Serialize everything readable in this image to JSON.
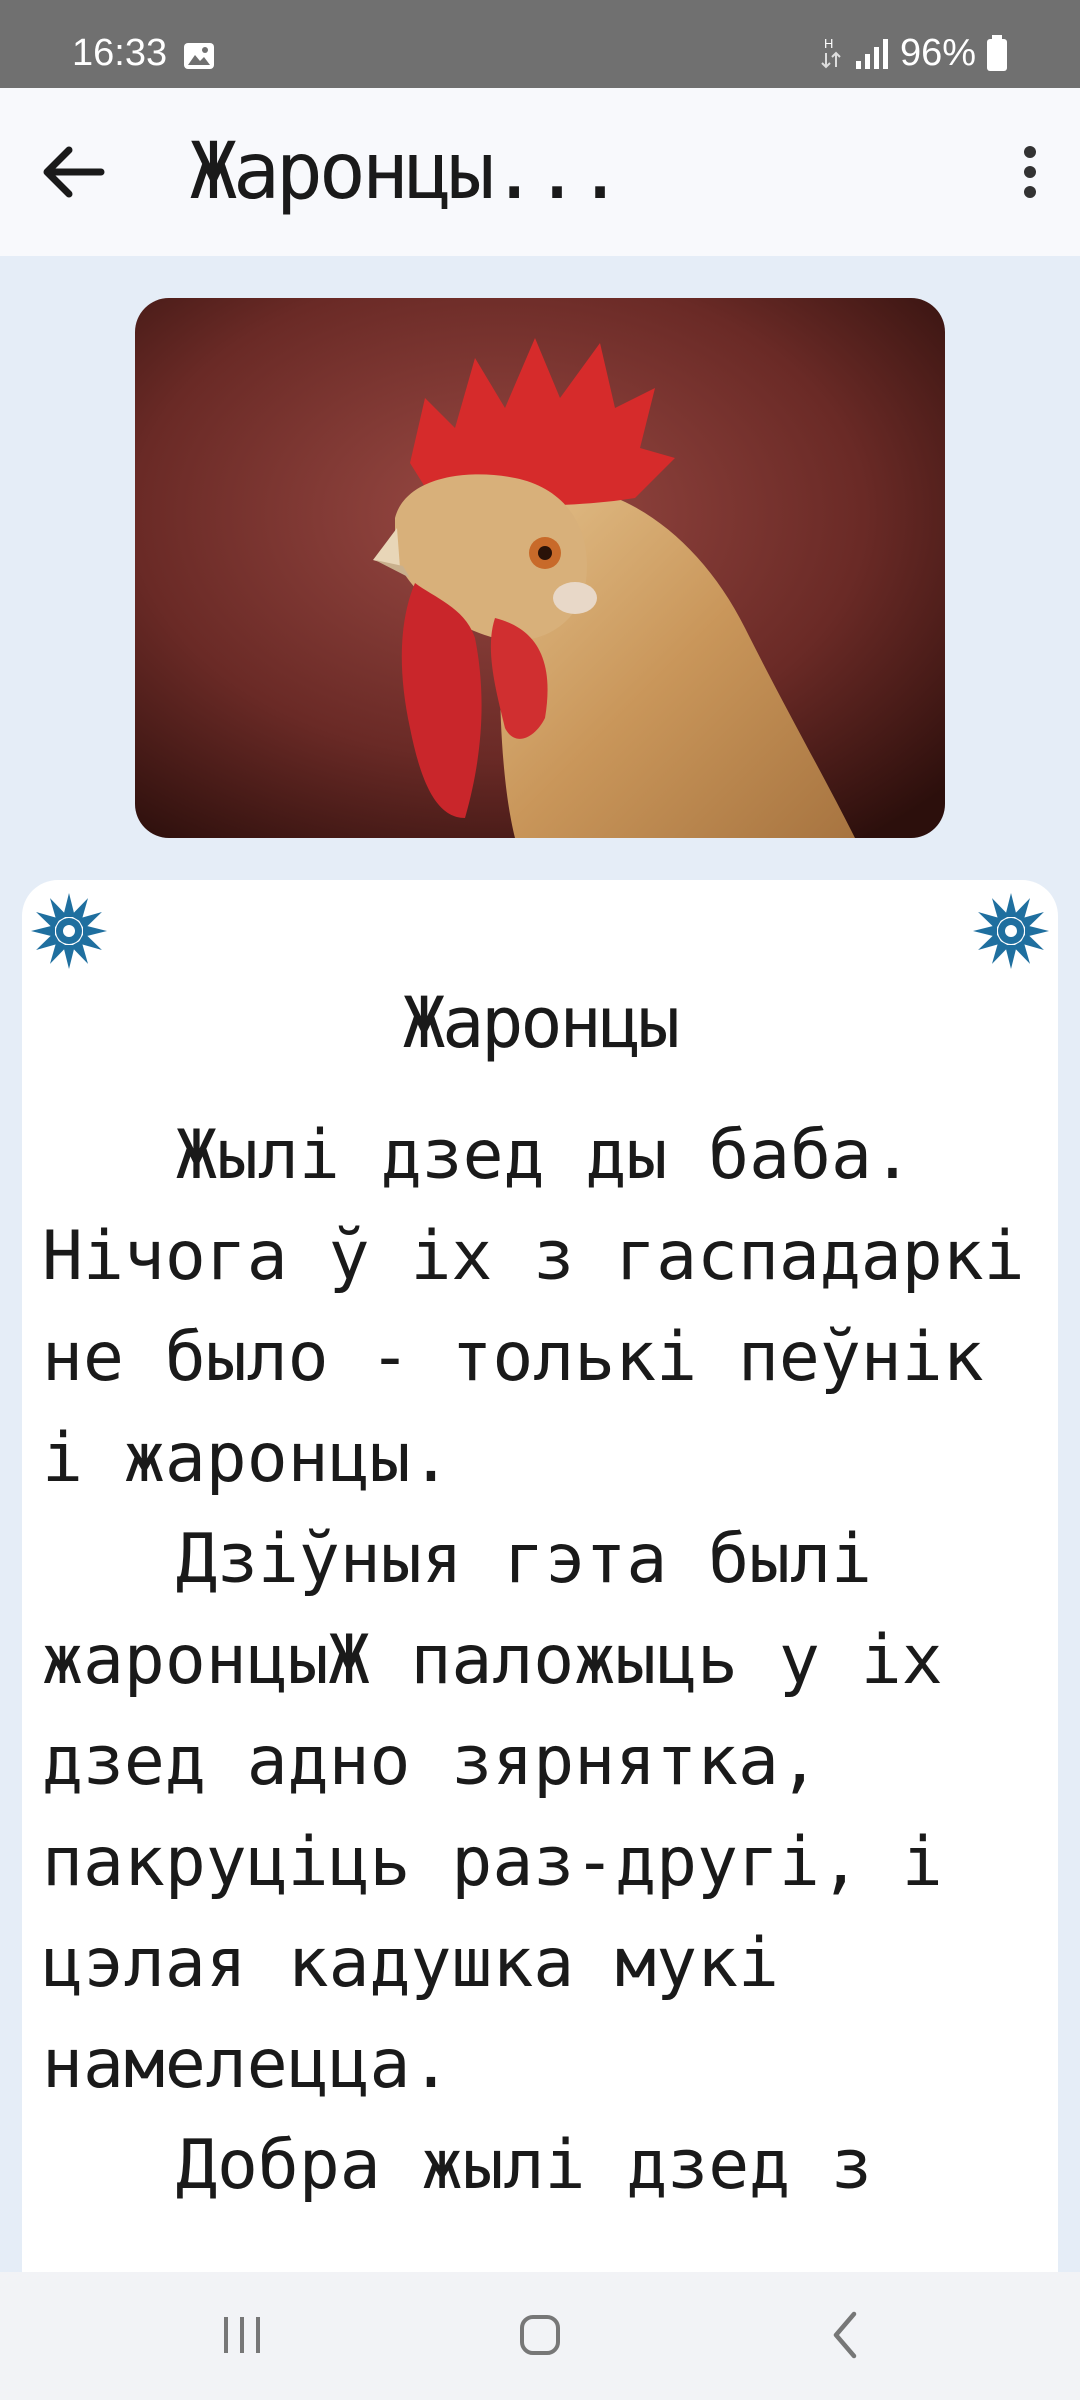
{
  "status_bar": {
    "time": "16:33",
    "battery": "96%",
    "icons": [
      "image-icon",
      "network-h-icon",
      "signal-icon",
      "battery-icon"
    ]
  },
  "app_bar": {
    "title": "Жаронцы...",
    "back_icon": "arrow-back-icon",
    "menu_icon": "more-vert-icon"
  },
  "hero": {
    "alt": "rooster-photo"
  },
  "story": {
    "title": "Жаронцы",
    "paragraphs": [
      "Жылі дзед ды баба. Нічога ў іх з гаспадаркі не было - толькі пеўнік і жаронцы.",
      "Дзіўныя гэта былі жаронцыЖ паложыць у іх дзед адно зярнятка, пакруціць раз-другі, і цэлая кадушка мукі намелецца.",
      "Добра жылі дзед з"
    ],
    "decoration_icon": "cornflower-icon"
  },
  "nav_bar": {
    "icons": [
      "recent-apps-icon",
      "home-icon",
      "back-icon"
    ]
  },
  "colors": {
    "status_bar": "#707070",
    "background": "#e5edf7",
    "accent": "#1f6f9f"
  }
}
